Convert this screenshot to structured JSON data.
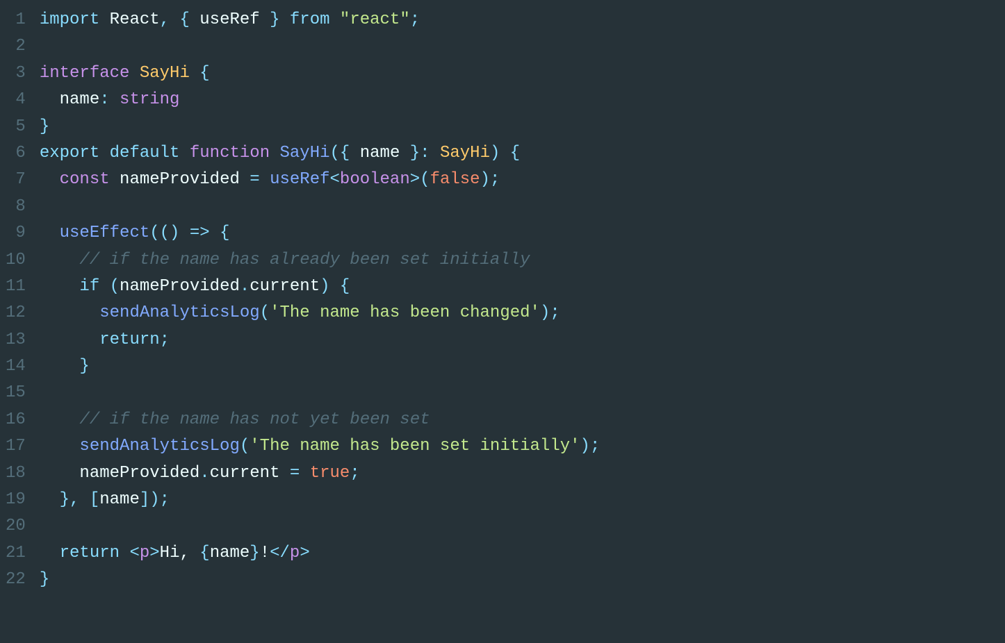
{
  "lineNumbers": [
    "1",
    "2",
    "3",
    "4",
    "5",
    "6",
    "7",
    "8",
    "9",
    "10",
    "11",
    "12",
    "13",
    "14",
    "15",
    "16",
    "17",
    "18",
    "19",
    "20",
    "21",
    "22"
  ],
  "code": {
    "lines": [
      {
        "tokens": [
          {
            "text": "import",
            "class": "keyword2"
          },
          {
            "text": " ",
            "class": "default"
          },
          {
            "text": "React",
            "class": "default"
          },
          {
            "text": ", { ",
            "class": "punctuation"
          },
          {
            "text": "useRef",
            "class": "default"
          },
          {
            "text": " } ",
            "class": "punctuation"
          },
          {
            "text": "from",
            "class": "keyword2"
          },
          {
            "text": " ",
            "class": "default"
          },
          {
            "text": "\"react\"",
            "class": "string"
          },
          {
            "text": ";",
            "class": "punctuation"
          }
        ]
      },
      {
        "tokens": []
      },
      {
        "tokens": [
          {
            "text": "interface",
            "class": "keyword"
          },
          {
            "text": " ",
            "class": "default"
          },
          {
            "text": "SayHi",
            "class": "type"
          },
          {
            "text": " {",
            "class": "punctuation"
          }
        ]
      },
      {
        "tokens": [
          {
            "text": "  ",
            "class": "default"
          },
          {
            "text": "name",
            "class": "default"
          },
          {
            "text": ": ",
            "class": "punctuation"
          },
          {
            "text": "string",
            "class": "keyword"
          }
        ]
      },
      {
        "tokens": [
          {
            "text": "}",
            "class": "punctuation"
          }
        ]
      },
      {
        "tokens": [
          {
            "text": "export",
            "class": "keyword2"
          },
          {
            "text": " ",
            "class": "default"
          },
          {
            "text": "default",
            "class": "keyword2"
          },
          {
            "text": " ",
            "class": "default"
          },
          {
            "text": "function",
            "class": "keyword"
          },
          {
            "text": " ",
            "class": "default"
          },
          {
            "text": "SayHi",
            "class": "function-name"
          },
          {
            "text": "({ ",
            "class": "punctuation"
          },
          {
            "text": "name",
            "class": "default"
          },
          {
            "text": " }: ",
            "class": "punctuation"
          },
          {
            "text": "SayHi",
            "class": "type"
          },
          {
            "text": ") {",
            "class": "punctuation"
          }
        ]
      },
      {
        "tokens": [
          {
            "text": "  ",
            "class": "default"
          },
          {
            "text": "const",
            "class": "keyword"
          },
          {
            "text": " ",
            "class": "default"
          },
          {
            "text": "nameProvided",
            "class": "default"
          },
          {
            "text": " = ",
            "class": "operator"
          },
          {
            "text": "useRef",
            "class": "function-name"
          },
          {
            "text": "<",
            "class": "punctuation"
          },
          {
            "text": "boolean",
            "class": "keyword"
          },
          {
            "text": ">(",
            "class": "punctuation"
          },
          {
            "text": "false",
            "class": "boolean"
          },
          {
            "text": ");",
            "class": "punctuation"
          }
        ]
      },
      {
        "tokens": []
      },
      {
        "tokens": [
          {
            "text": "  ",
            "class": "default"
          },
          {
            "text": "useEffect",
            "class": "function-name"
          },
          {
            "text": "(() ",
            "class": "punctuation"
          },
          {
            "text": "=>",
            "class": "operator"
          },
          {
            "text": " {",
            "class": "punctuation"
          }
        ]
      },
      {
        "tokens": [
          {
            "text": "    ",
            "class": "default"
          },
          {
            "text": "// if the name has already been set initially",
            "class": "comment"
          }
        ]
      },
      {
        "tokens": [
          {
            "text": "    ",
            "class": "default"
          },
          {
            "text": "if",
            "class": "keyword2"
          },
          {
            "text": " (",
            "class": "punctuation"
          },
          {
            "text": "nameProvided",
            "class": "default"
          },
          {
            "text": ".",
            "class": "punctuation"
          },
          {
            "text": "current",
            "class": "default"
          },
          {
            "text": ") {",
            "class": "punctuation"
          }
        ]
      },
      {
        "tokens": [
          {
            "text": "      ",
            "class": "default"
          },
          {
            "text": "sendAnalyticsLog",
            "class": "function-name"
          },
          {
            "text": "(",
            "class": "punctuation"
          },
          {
            "text": "'The name has been changed'",
            "class": "string"
          },
          {
            "text": ");",
            "class": "punctuation"
          }
        ]
      },
      {
        "tokens": [
          {
            "text": "      ",
            "class": "default"
          },
          {
            "text": "return",
            "class": "keyword2"
          },
          {
            "text": ";",
            "class": "punctuation"
          }
        ]
      },
      {
        "tokens": [
          {
            "text": "    }",
            "class": "punctuation"
          }
        ]
      },
      {
        "tokens": []
      },
      {
        "tokens": [
          {
            "text": "    ",
            "class": "default"
          },
          {
            "text": "// if the name has not yet been set",
            "class": "comment"
          }
        ]
      },
      {
        "tokens": [
          {
            "text": "    ",
            "class": "default"
          },
          {
            "text": "sendAnalyticsLog",
            "class": "function-name"
          },
          {
            "text": "(",
            "class": "punctuation"
          },
          {
            "text": "'The name has been set initially'",
            "class": "string"
          },
          {
            "text": ");",
            "class": "punctuation"
          }
        ]
      },
      {
        "tokens": [
          {
            "text": "    ",
            "class": "default"
          },
          {
            "text": "nameProvided",
            "class": "default"
          },
          {
            "text": ".",
            "class": "punctuation"
          },
          {
            "text": "current",
            "class": "default"
          },
          {
            "text": " = ",
            "class": "operator"
          },
          {
            "text": "true",
            "class": "boolean"
          },
          {
            "text": ";",
            "class": "punctuation"
          }
        ]
      },
      {
        "tokens": [
          {
            "text": "  }, [",
            "class": "punctuation"
          },
          {
            "text": "name",
            "class": "default"
          },
          {
            "text": "]);",
            "class": "punctuation"
          }
        ]
      },
      {
        "tokens": []
      },
      {
        "tokens": [
          {
            "text": "  ",
            "class": "default"
          },
          {
            "text": "return",
            "class": "keyword2"
          },
          {
            "text": " ",
            "class": "default"
          },
          {
            "text": "<",
            "class": "punctuation"
          },
          {
            "text": "p",
            "class": "keyword"
          },
          {
            "text": ">",
            "class": "punctuation"
          },
          {
            "text": "Hi, ",
            "class": "default"
          },
          {
            "text": "{",
            "class": "punctuation"
          },
          {
            "text": "name",
            "class": "default"
          },
          {
            "text": "}",
            "class": "punctuation"
          },
          {
            "text": "!",
            "class": "default"
          },
          {
            "text": "</",
            "class": "punctuation"
          },
          {
            "text": "p",
            "class": "keyword"
          },
          {
            "text": ">",
            "class": "punctuation"
          }
        ]
      },
      {
        "tokens": [
          {
            "text": "}",
            "class": "punctuation"
          }
        ]
      }
    ]
  }
}
